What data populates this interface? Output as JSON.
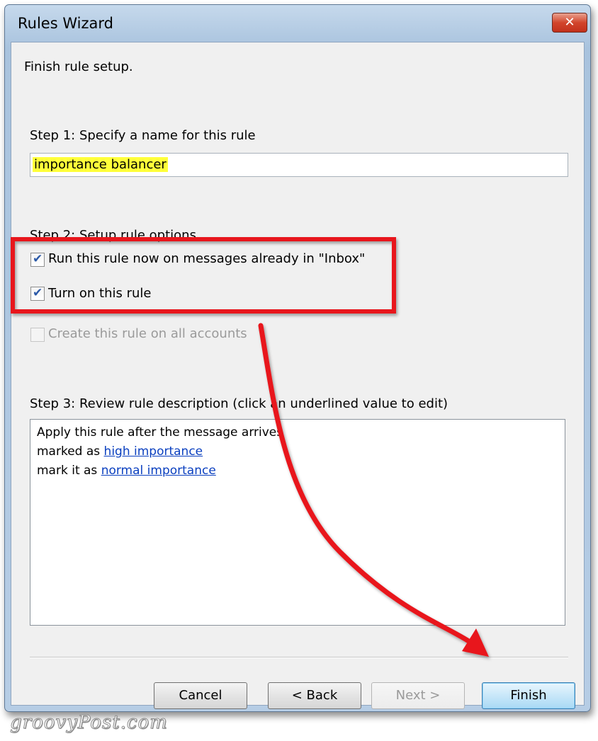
{
  "window": {
    "title": "Rules Wizard",
    "close_icon": "close-icon"
  },
  "header": "Finish rule setup.",
  "step1": {
    "label": "Step 1: Specify a name for this rule",
    "name_value": "importance balancer"
  },
  "step2": {
    "label": "Step 2: Setup rule options",
    "options": [
      {
        "label": "Run this rule now on messages already in \"Inbox\"",
        "checked": true,
        "enabled": true
      },
      {
        "label": "Turn on this rule",
        "checked": true,
        "enabled": true
      },
      {
        "label": "Create this rule on all accounts",
        "checked": false,
        "enabled": false
      }
    ]
  },
  "step3": {
    "label": "Step 3: Review rule description (click an underlined value to edit)",
    "lines": [
      {
        "text": "Apply this rule after the message arrives",
        "link": ""
      },
      {
        "text": "marked as ",
        "link": "high importance"
      },
      {
        "text": "mark it as ",
        "link": "normal importance"
      }
    ]
  },
  "buttons": {
    "cancel": "Cancel",
    "back": "< Back",
    "next": "Next >",
    "finish": "Finish"
  },
  "annotation": {
    "highlight_color": "#e8141c",
    "arrow_color": "#e8141c"
  },
  "watermark": "groovyPost.com",
  "colors": {
    "highlight_fill": "#ffff3a",
    "link": "#0a3fbf",
    "default_button": "#a9d9f5"
  }
}
